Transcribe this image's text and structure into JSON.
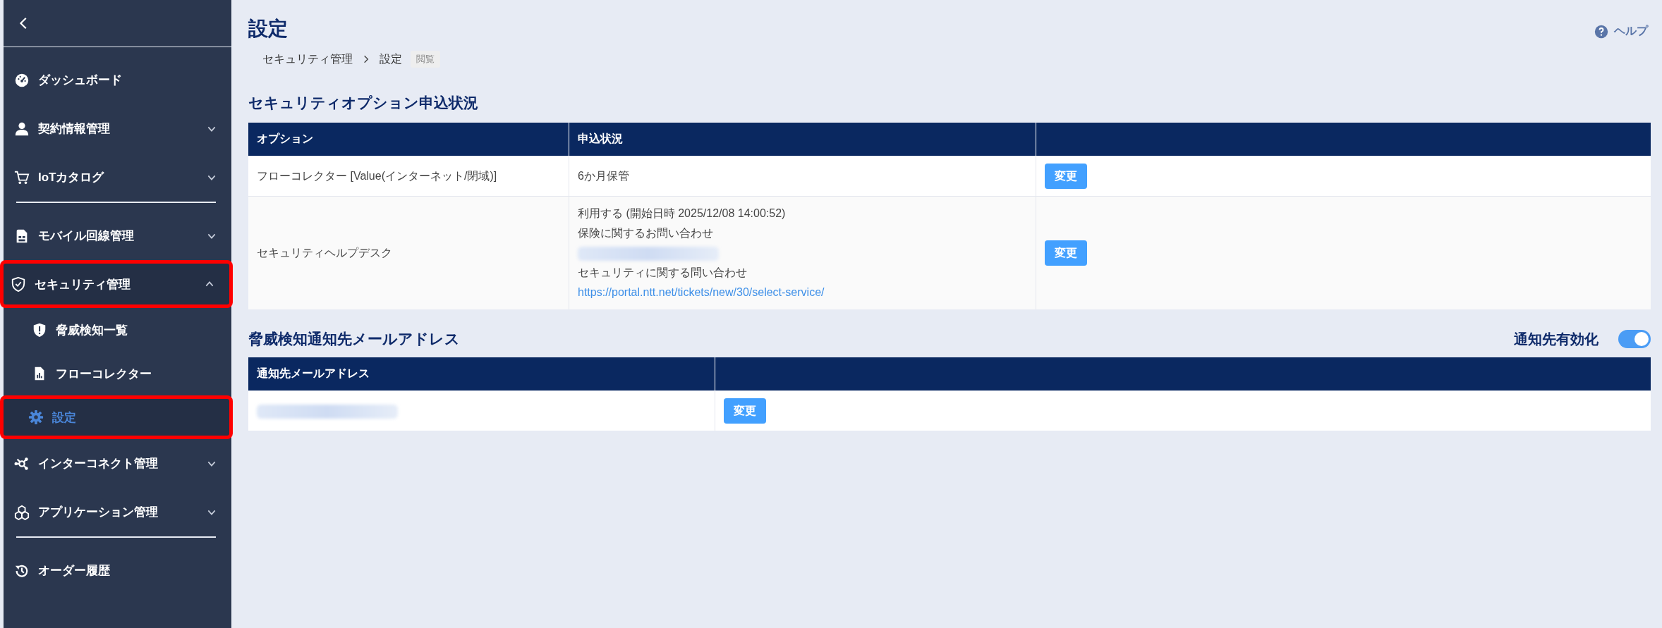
{
  "sidebar": {
    "sections": [
      [
        {
          "label": "ダッシュボード",
          "expandable": false,
          "selected": false,
          "highlighted": false
        },
        {
          "label": "契約情報管理",
          "expandable": true,
          "expanded": false,
          "selected": false,
          "highlighted": false
        },
        {
          "label": "IoTカタログ",
          "expandable": true,
          "expanded": false,
          "selected": false,
          "highlighted": false
        }
      ],
      [
        {
          "label": "モバイル回線管理",
          "expandable": true,
          "expanded": false,
          "selected": false,
          "highlighted": false
        },
        {
          "label": "セキュリティ管理",
          "expandable": true,
          "expanded": true,
          "selected": false,
          "highlighted": true,
          "children": [
            {
              "label": "脅威検知一覧",
              "selected": false,
              "highlighted": false
            },
            {
              "label": "フローコレクター",
              "selected": false,
              "highlighted": false
            },
            {
              "label": "設定",
              "selected": true,
              "highlighted": true
            }
          ]
        },
        {
          "label": "インターコネクト管理",
          "expandable": true,
          "expanded": false,
          "selected": false,
          "highlighted": false
        },
        {
          "label": "アプリケーション管理",
          "expandable": true,
          "expanded": false,
          "selected": false,
          "highlighted": false
        }
      ],
      [
        {
          "label": "オーダー履歴",
          "expandable": false,
          "selected": false,
          "highlighted": false
        }
      ]
    ]
  },
  "header": {
    "title": "設定",
    "help": "ヘルプ",
    "breadcrumb": [
      "セキュリティ管理",
      "設定"
    ],
    "badge": "閲覧"
  },
  "options_section": {
    "title": "セキュリティオプション申込状況",
    "columns": [
      "オプション",
      "申込状況"
    ],
    "rows": [
      {
        "option": "フローコレクター [Value(インターネット/閉域)]",
        "status": [
          {
            "kind": "text",
            "text": "6か月保管"
          }
        ],
        "button": "変更"
      },
      {
        "option": "セキュリティヘルプデスク",
        "status": [
          {
            "kind": "text",
            "text": "利用する (開始日時 2025/12/08 14:00:52)"
          },
          {
            "kind": "text",
            "text": "保険に関するお問い合わせ"
          },
          {
            "kind": "redacted"
          },
          {
            "kind": "text",
            "text": "セキュリティに関する問い合わせ"
          },
          {
            "kind": "link",
            "text": "https://portal.ntt.net/tickets/new/30/select-service/"
          }
        ],
        "button": "変更"
      }
    ]
  },
  "notify_section": {
    "title": "脅威検知通知先メールアドレス",
    "toggle": {
      "label": "通知先有効化",
      "on": true
    },
    "columns": [
      "通知先メールアドレス"
    ],
    "rows": [
      {
        "address": {
          "kind": "redacted"
        },
        "button": "変更"
      }
    ]
  }
}
